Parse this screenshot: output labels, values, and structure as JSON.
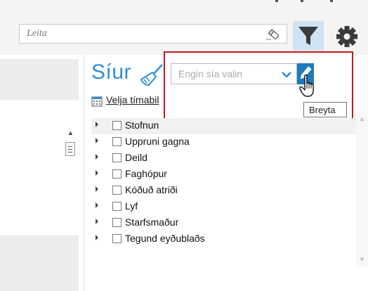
{
  "search": {
    "placeholder": "Leita"
  },
  "filters": {
    "title": "Síur",
    "selected_value": "Engin sía valin",
    "edit_tooltip": "Breyta",
    "period_link": "Velja tímabil",
    "items": [
      {
        "label": "Stofnun"
      },
      {
        "label": "Uppruni gagna"
      },
      {
        "label": "Deild"
      },
      {
        "label": "Faghópur"
      },
      {
        "label": "Kóðuð atriði"
      },
      {
        "label": "Lyf"
      },
      {
        "label": "Starfsmaður"
      },
      {
        "label": "Tegund eyðublaðs"
      }
    ]
  },
  "icons": {
    "search_clear": "eraser-icon",
    "filter": "funnel-icon",
    "settings": "gear-icon",
    "clear_filters": "broom-icon",
    "dropdown": "chevron-down-icon",
    "edit": "pencil-icon",
    "calendar": "calendar-icon",
    "cursor": "hand-cursor-icon"
  },
  "colors": {
    "accent": "#2f8fd8",
    "highlight": "#c4181c",
    "edit_button": "#1f7bbf",
    "filter_button_bg": "#cfe3f3"
  }
}
